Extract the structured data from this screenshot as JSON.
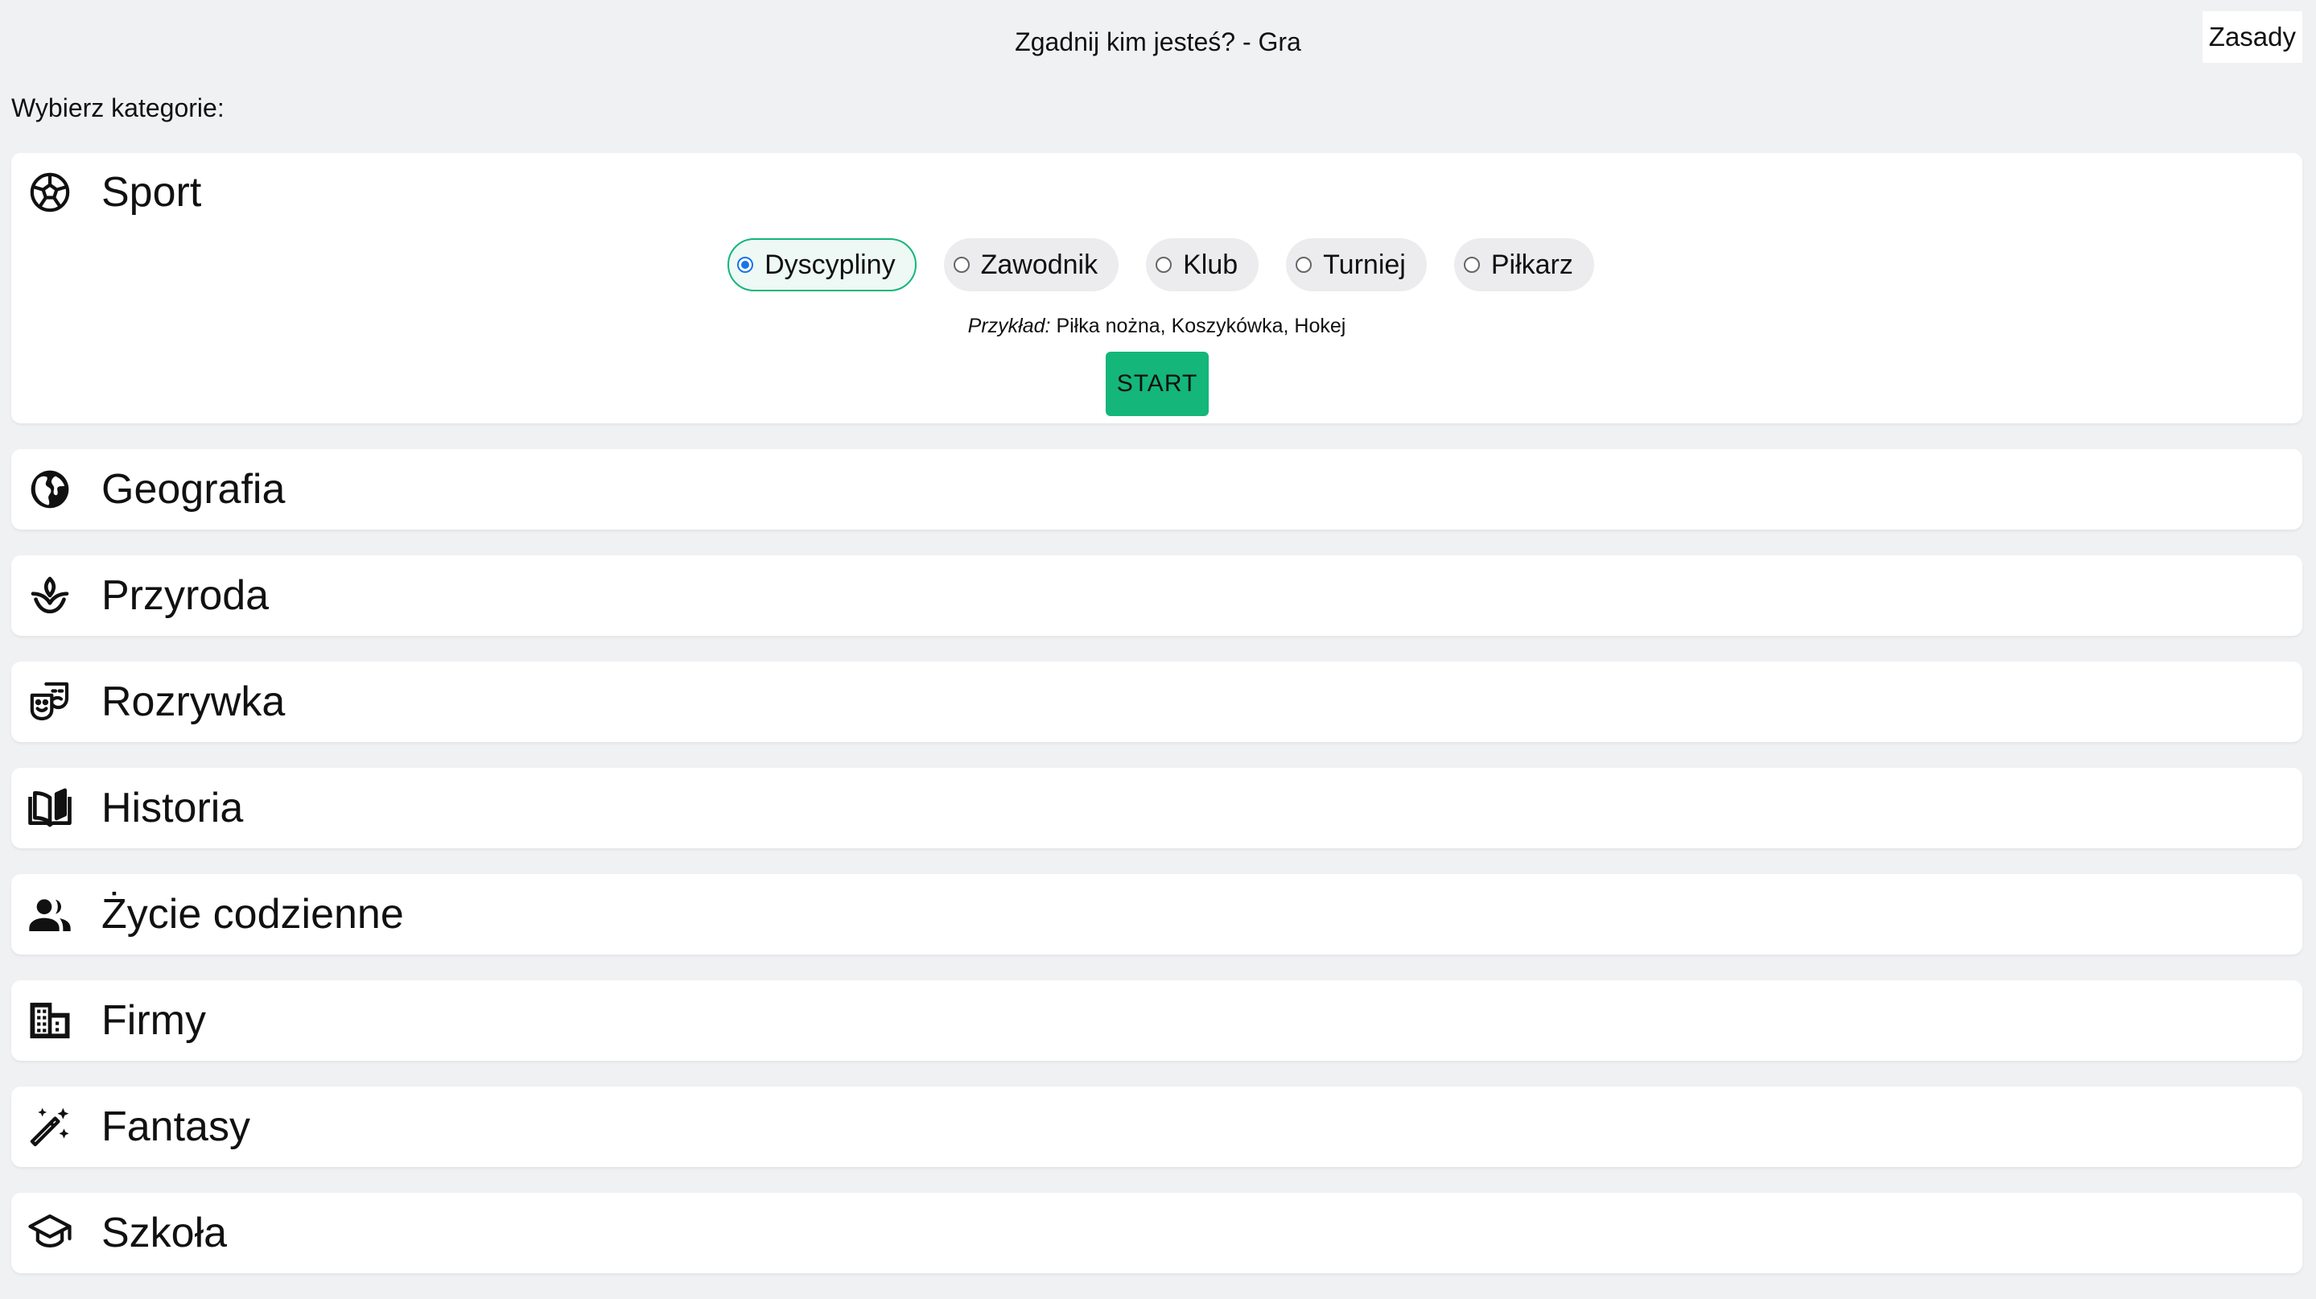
{
  "header": {
    "title": "Zgadnij kim jesteś? - Gra",
    "rules_label": "Zasady"
  },
  "section_label": "Wybierz kategorie:",
  "categories": [
    {
      "label": "Sport",
      "icon": "soccer-ball-icon"
    },
    {
      "label": "Geografia",
      "icon": "globe-icon"
    },
    {
      "label": "Przyroda",
      "icon": "plant-icon"
    },
    {
      "label": "Rozrywka",
      "icon": "theater-masks-icon"
    },
    {
      "label": "Historia",
      "icon": "book-icon"
    },
    {
      "label": "Życie codzienne",
      "icon": "people-icon"
    },
    {
      "label": "Firmy",
      "icon": "building-icon"
    },
    {
      "label": "Fantasy",
      "icon": "magic-wand-icon"
    },
    {
      "label": "Szkoła",
      "icon": "graduation-cap-icon"
    }
  ],
  "sport_panel": {
    "options": [
      {
        "label": "Dyscypliny",
        "selected": true
      },
      {
        "label": "Zawodnik",
        "selected": false
      },
      {
        "label": "Klub",
        "selected": false
      },
      {
        "label": "Turniej",
        "selected": false
      },
      {
        "label": "Piłkarz",
        "selected": false
      }
    ],
    "example_prefix": "Przykład:",
    "example_text": "Piłka nożna, Koszykówka, Hokej",
    "start_label": "START"
  },
  "colors": {
    "accent": "#14b67a",
    "background": "#f0f1f3",
    "card": "#ffffff",
    "radio_selected": "#1a73e8"
  }
}
